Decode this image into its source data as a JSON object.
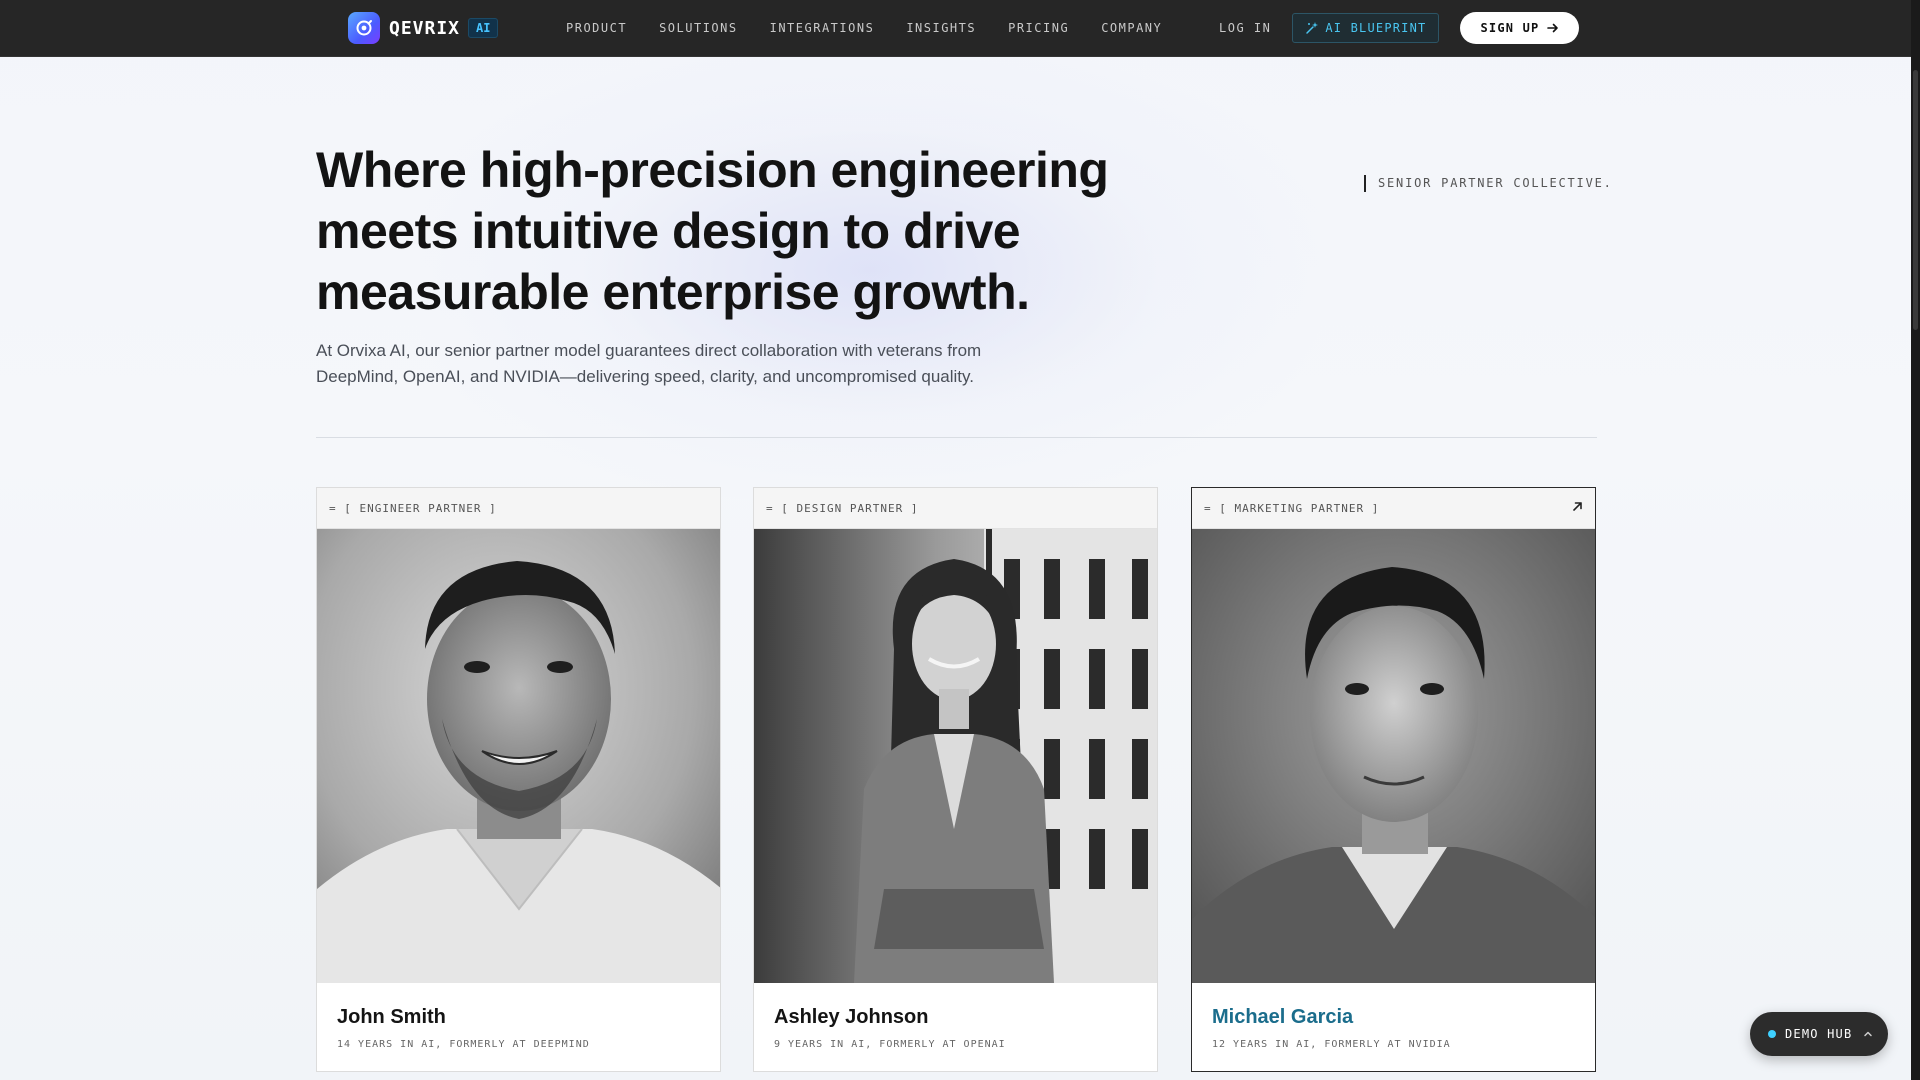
{
  "nav": {
    "brand": "QEVRIX",
    "brand_badge": "AI",
    "links": [
      "PRODUCT",
      "SOLUTIONS",
      "INTEGRATIONS",
      "INSIGHTS",
      "PRICING",
      "COMPANY"
    ],
    "login": "LOG IN",
    "blueprint": "AI BLUEPRINT",
    "signup": "SIGN UP"
  },
  "hero": {
    "title_lines": [
      "Where high-precision engineering",
      "meets intuitive design to drive",
      "measurable enterprise growth."
    ],
    "subtitle_lines": [
      "At Orvixa AI, our senior partner model guarantees direct collaboration with veterans from",
      "DeepMind, OpenAI, and NVIDIA—delivering speed, clarity, and uncompromised quality."
    ],
    "tagline": "SENIOR PARTNER COLLECTIVE."
  },
  "partners": [
    {
      "tag": "= [ ENGINEER PARTNER ]",
      "name": "John Smith",
      "meta": "14 YEARS IN AI, FORMERLY AT DEEPMIND"
    },
    {
      "tag": "= [ DESIGN PARTNER ]",
      "name": "Ashley Johnson",
      "meta": "9 YEARS IN AI, FORMERLY AT OPENAI"
    },
    {
      "tag": "= [ MARKETING PARTNER ]",
      "name": "Michael Garcia",
      "meta": "12 YEARS IN AI, FORMERLY AT NVIDIA"
    }
  ],
  "demo_hub": {
    "label": "DEMO HUB"
  },
  "colors": {
    "nav_bg": "#262626",
    "accent_cyan": "#46c3ff",
    "active_name": "#1b6d8c",
    "hub_dot": "#3ed0ff"
  }
}
